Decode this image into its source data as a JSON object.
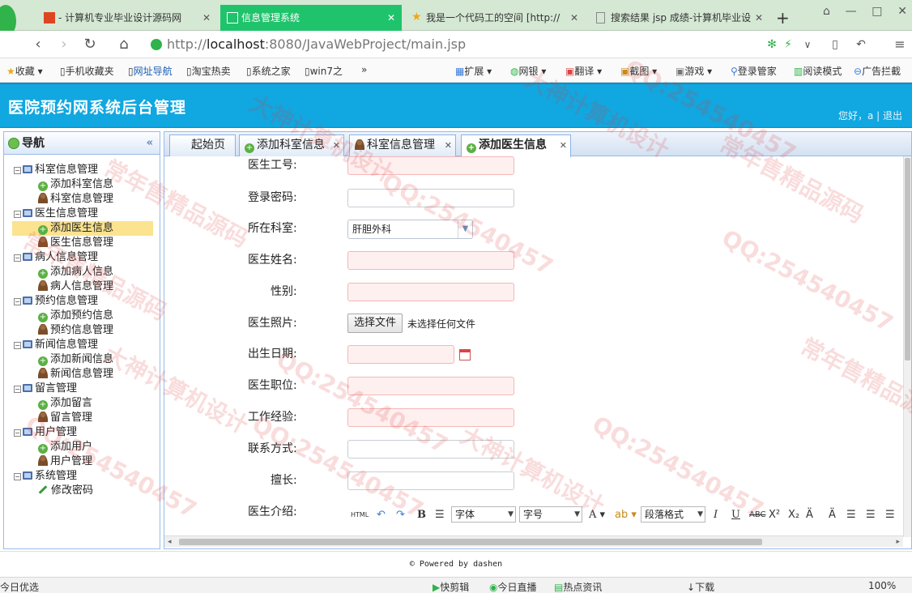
{
  "browser": {
    "tabs": [
      {
        "label": "- 计算机专业毕业设计源码网",
        "icon": "site-favicon-icon",
        "active": false
      },
      {
        "label": "信息管理系统",
        "icon": "page-icon",
        "active": true
      },
      {
        "label": "我是一个代码工的空间 [http://",
        "icon": "star-icon",
        "active": false
      },
      {
        "label": "搜索结果 jsp 成绩-计算机毕业设",
        "icon": "page-icon",
        "active": false
      }
    ],
    "new_tab_label": "+",
    "url_prefix": "http://",
    "url_host": "localhost",
    "url_rest": ":8080/JavaWebProject/main.jsp",
    "bookmarks": [
      {
        "label": "收藏",
        "icon": "star-icon"
      },
      {
        "label": "手机收藏夹",
        "icon": "page-icon"
      },
      {
        "label": "网址导航",
        "icon": "page-icon"
      },
      {
        "label": "淘宝热卖",
        "icon": "page-icon"
      },
      {
        "label": "系统之家",
        "icon": "page-icon"
      },
      {
        "label": "win7之",
        "icon": "page-icon"
      }
    ],
    "bookmark_more": "»",
    "tools": [
      {
        "label": "扩展",
        "icon": "extension-icon"
      },
      {
        "label": "网银",
        "icon": "bank-icon"
      },
      {
        "label": "翻译",
        "icon": "translate-icon"
      },
      {
        "label": "截图",
        "icon": "screenshot-icon"
      },
      {
        "label": "游戏",
        "icon": "game-icon"
      },
      {
        "label": "登录管家",
        "icon": "key-icon"
      },
      {
        "label": "阅读模式",
        "icon": "book-icon"
      },
      {
        "label": "广告拦截",
        "icon": "block-icon"
      }
    ]
  },
  "app": {
    "title": "医院预约网系统后台管理",
    "greeting": "您好，a",
    "logout": "退出"
  },
  "sidebar": {
    "title": "导航",
    "collapse_icon": "«",
    "groups": [
      {
        "label": "科室信息管理",
        "items": [
          {
            "label": "添加科室信息",
            "type": "add"
          },
          {
            "label": "科室信息管理",
            "type": "user"
          }
        ]
      },
      {
        "label": "医生信息管理",
        "items": [
          {
            "label": "添加医生信息",
            "type": "add",
            "selected": true
          },
          {
            "label": "医生信息管理",
            "type": "user"
          }
        ]
      },
      {
        "label": "病人信息管理",
        "items": [
          {
            "label": "添加病人信息",
            "type": "add"
          },
          {
            "label": "病人信息管理",
            "type": "user"
          }
        ]
      },
      {
        "label": "预约信息管理",
        "items": [
          {
            "label": "添加预约信息",
            "type": "add"
          },
          {
            "label": "预约信息管理",
            "type": "user"
          }
        ]
      },
      {
        "label": "新闻信息管理",
        "items": [
          {
            "label": "添加新闻信息",
            "type": "add"
          },
          {
            "label": "新闻信息管理",
            "type": "user"
          }
        ]
      },
      {
        "label": "留言管理",
        "items": [
          {
            "label": "添加留言",
            "type": "add"
          },
          {
            "label": "留言管理",
            "type": "user"
          }
        ]
      },
      {
        "label": "用户管理",
        "items": [
          {
            "label": "添加用户",
            "type": "add"
          },
          {
            "label": "用户管理",
            "type": "user"
          }
        ]
      },
      {
        "label": "系统管理",
        "items": [
          {
            "label": "修改密码",
            "type": "pen"
          }
        ]
      }
    ]
  },
  "panel_tabs": [
    {
      "label": "起始页",
      "icon": null,
      "closable": false
    },
    {
      "label": "添加科室信息",
      "icon": "add",
      "closable": true
    },
    {
      "label": "科室信息管理",
      "icon": "user",
      "closable": true
    },
    {
      "label": "添加医生信息",
      "icon": "add",
      "closable": true,
      "active": true
    }
  ],
  "form": {
    "fields": [
      {
        "label": "医生工号:",
        "type": "text",
        "required": true
      },
      {
        "label": "登录密码:",
        "type": "password",
        "required": false
      },
      {
        "label": "所在科室:",
        "type": "select",
        "value": "肝胆外科"
      },
      {
        "label": "医生姓名:",
        "type": "text",
        "required": true
      },
      {
        "label": "性别:",
        "type": "text",
        "required": true
      },
      {
        "label": "医生照片:",
        "type": "file",
        "button": "选择文件",
        "status": "未选择任何文件"
      },
      {
        "label": "出生日期:",
        "type": "date",
        "required": true
      },
      {
        "label": "医生职位:",
        "type": "text",
        "required": true
      },
      {
        "label": "工作经验:",
        "type": "text",
        "required": true
      },
      {
        "label": "联系方式:",
        "type": "text",
        "required": false
      },
      {
        "label": "擅长:",
        "type": "text",
        "required": false
      },
      {
        "label": "医生介绍:",
        "type": "editor"
      }
    ],
    "editor_toolbar": {
      "html": "HTML",
      "font_label": "字体",
      "size_label": "字号",
      "paragraph_label": "段落格式"
    }
  },
  "footer": {
    "powered": "Powered by dashen"
  },
  "statusbar": {
    "left": "今日优选",
    "items": [
      "快剪辑",
      "今日直播",
      "热点资讯",
      "下载"
    ],
    "zoom": "100%"
  },
  "watermark": [
    "QQ:254540457",
    "常年售精品源码",
    "大神计算机设计"
  ]
}
